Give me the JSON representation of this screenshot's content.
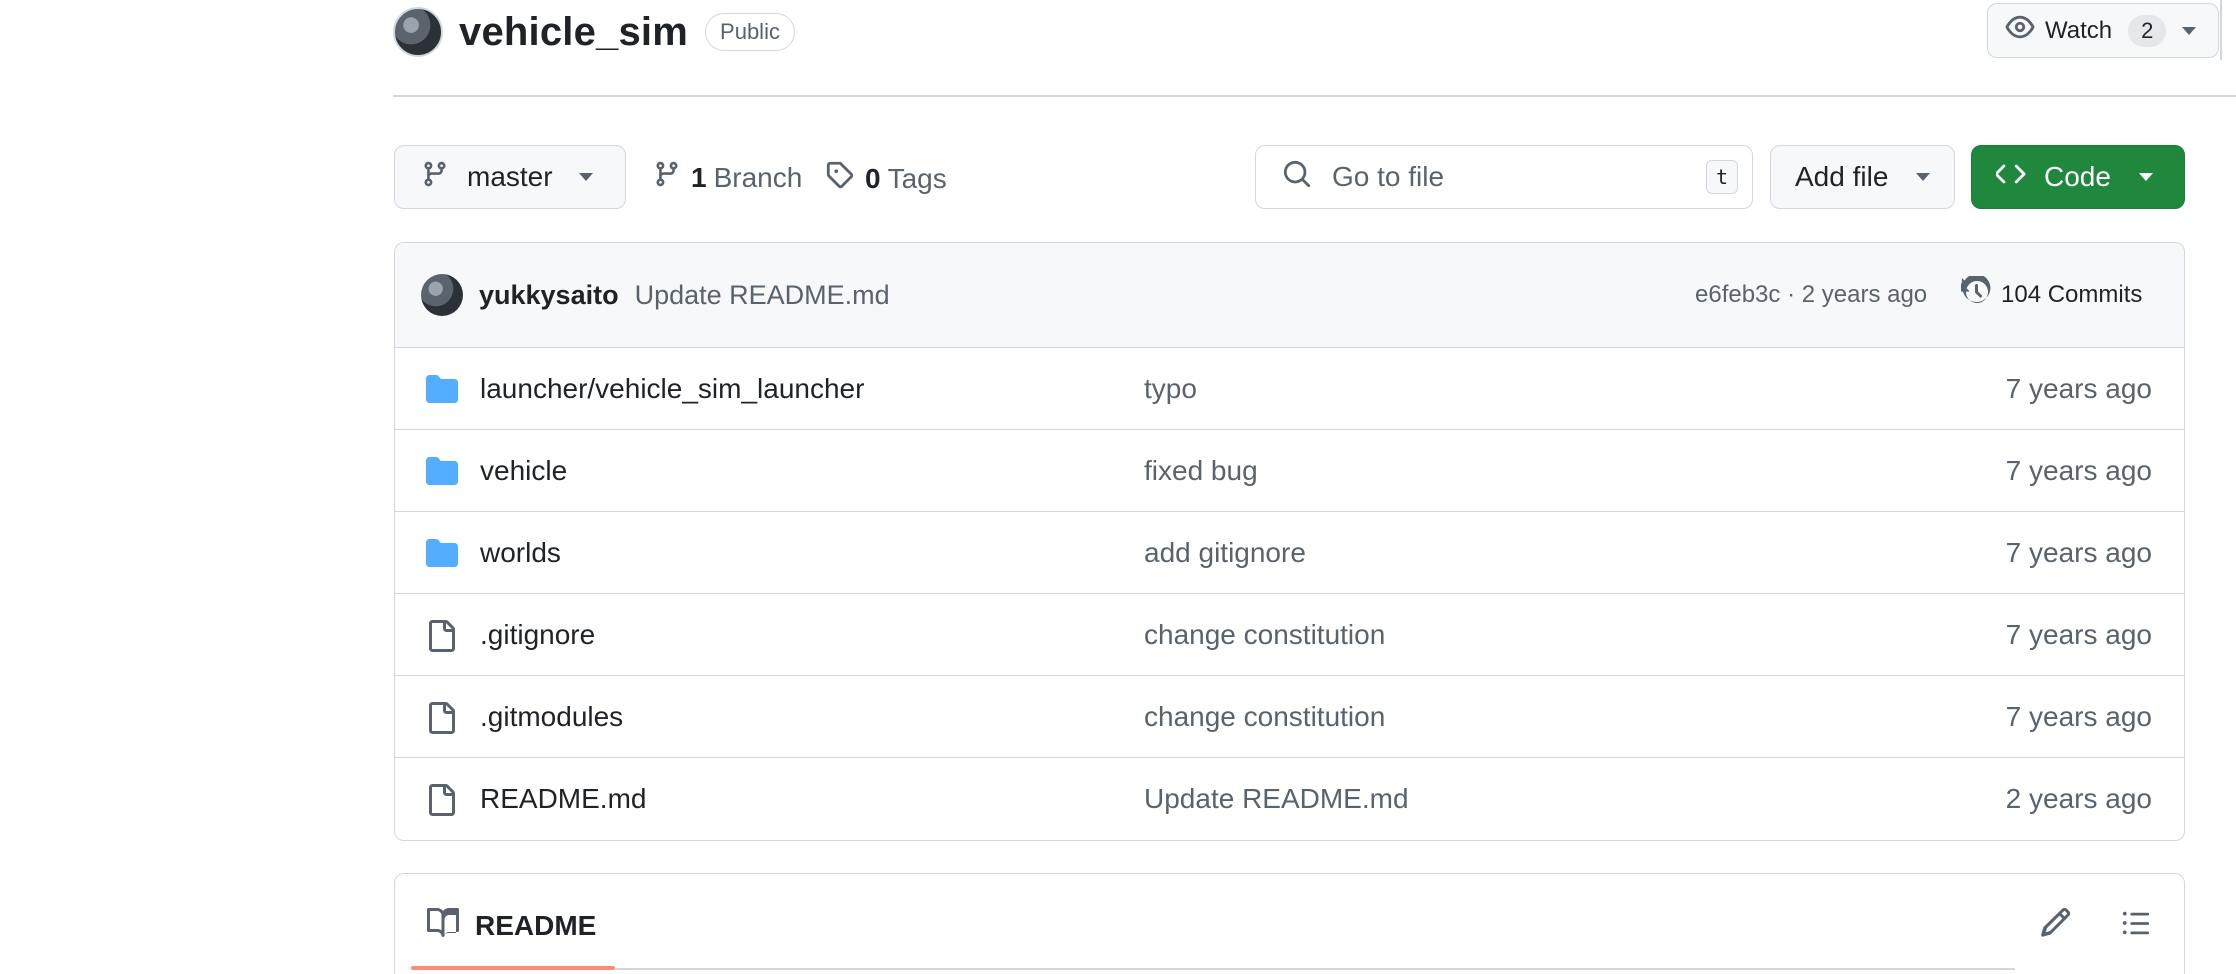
{
  "repo": {
    "name": "vehicle_sim",
    "visibility": "Public",
    "watch_label": "Watch",
    "watch_count": "2"
  },
  "toolbar": {
    "branch": "master",
    "branch_count": "1",
    "branch_word": "Branch",
    "tag_count": "0",
    "tag_word": "Tags",
    "goto_placeholder": "Go to file",
    "goto_shortcut": "t",
    "add_file": "Add file",
    "code": "Code"
  },
  "latest_commit": {
    "author": "yukkysaito",
    "message": "Update README.md",
    "meta": "e6feb3c · 2 years ago",
    "commits": "104 Commits"
  },
  "files": [
    {
      "icon": "folder-icon",
      "name": "launcher/vehicle_sim_launcher",
      "message": "typo",
      "age": "7 years ago"
    },
    {
      "icon": "folder-icon",
      "name": "vehicle",
      "message": "fixed bug",
      "age": "7 years ago"
    },
    {
      "icon": "folder-icon",
      "name": "worlds",
      "message": "add gitignore",
      "age": "7 years ago"
    },
    {
      "icon": "file-icon",
      "name": ".gitignore",
      "message": "change constitution",
      "age": "7 years ago"
    },
    {
      "icon": "file-icon",
      "name": ".gitmodules",
      "message": "change constitution",
      "age": "7 years ago"
    },
    {
      "icon": "file-icon",
      "name": "README.md",
      "message": "Update README.md",
      "age": "2 years ago"
    }
  ],
  "readme": {
    "tab": "README"
  },
  "colors": {
    "code_button": "#1f883d",
    "folder": "#54aeff",
    "readme_underline": "#fd8c73"
  }
}
